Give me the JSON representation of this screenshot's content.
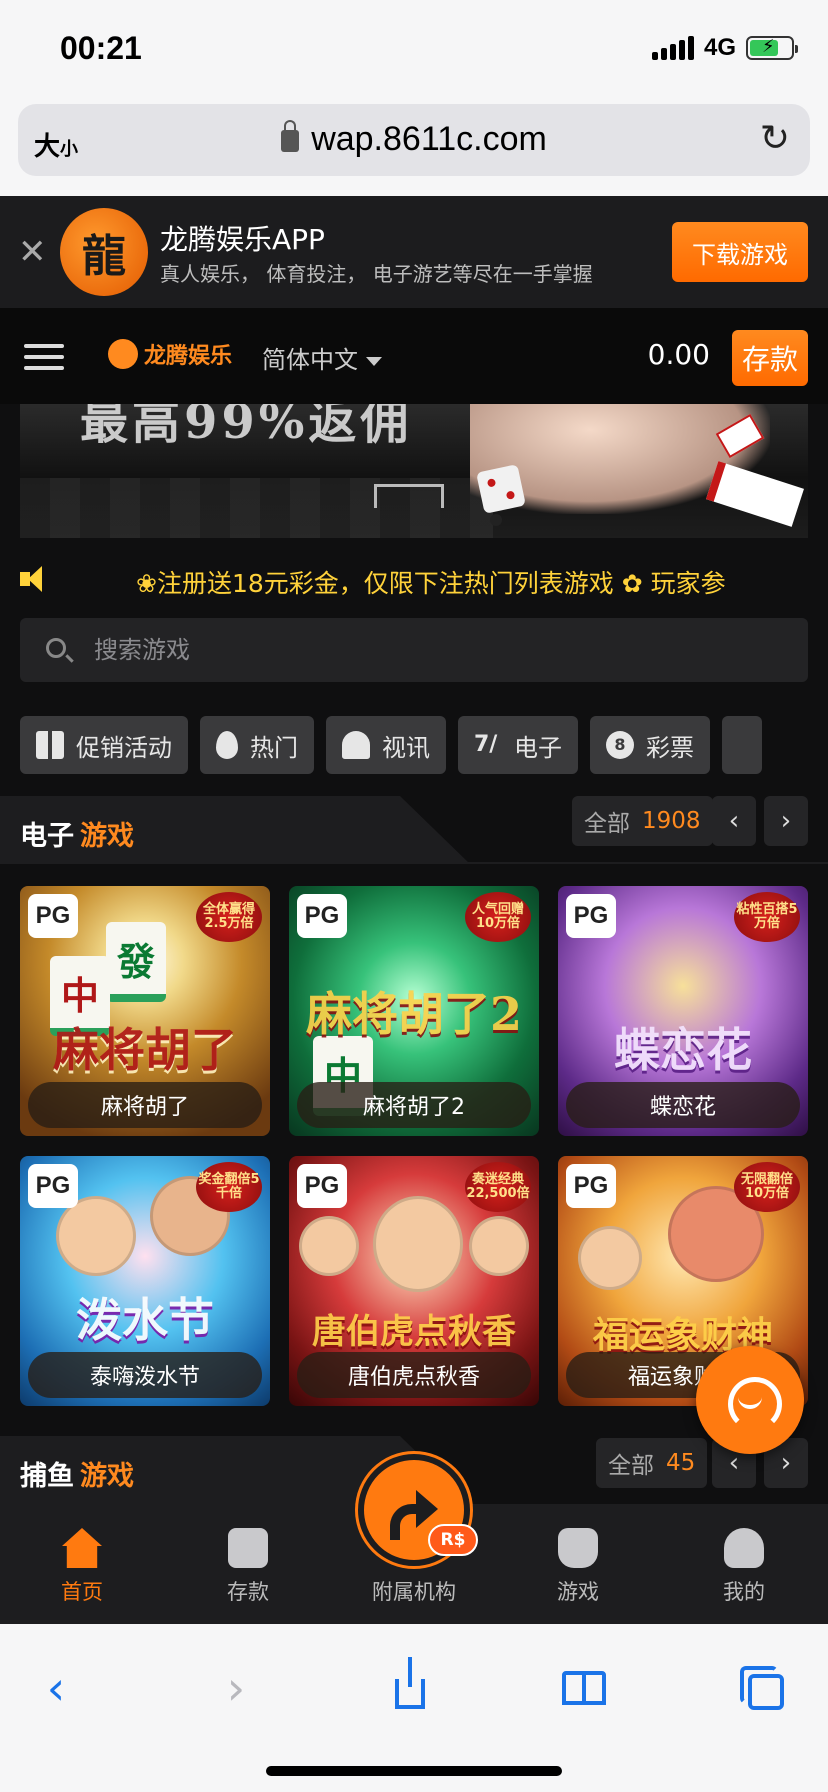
{
  "status_bar": {
    "time": "00:21",
    "network": "4G"
  },
  "browser": {
    "text_size_label": "大",
    "text_size_small": "小",
    "url": "wap.8611c.com"
  },
  "app_banner": {
    "title": "龙腾娱乐APP",
    "subtitle": "真人娱乐， 体育投注， 电子游艺等尽在一手掌握",
    "download_label": "下载游戏"
  },
  "header": {
    "brand": "龙腾娱乐",
    "language": "简体中文",
    "balance": "0.00",
    "deposit_label": "存款"
  },
  "hero": {
    "text": "最高99%返佣"
  },
  "marquee": {
    "text": "❀注册送18元彩金，仅限下注热门列表游戏     ✿ 玩家参"
  },
  "search": {
    "placeholder": "搜索游戏"
  },
  "tabs": [
    {
      "label": "促销活动",
      "icon": "gift-icon"
    },
    {
      "label": "热门",
      "icon": "fire-icon"
    },
    {
      "label": "视讯",
      "icon": "live-dealer-icon"
    },
    {
      "label": "电子",
      "icon": "slot-icon"
    },
    {
      "label": "彩票",
      "icon": "lottery-ball-icon",
      "ball_number": "8"
    }
  ],
  "slots_section": {
    "title_main": "电子",
    "title_accent": "游戏",
    "all_label": "全部",
    "count": "1908",
    "games": [
      {
        "name": "麻将胡了",
        "provider": "PG",
        "tag": "全体赢得2.5万倍",
        "art_title": "麻将胡了"
      },
      {
        "name": "麻将胡了2",
        "provider": "PG",
        "tag": "人气回赠10万倍",
        "art_title": "麻将胡了2"
      },
      {
        "name": "蝶恋花",
        "provider": "PG",
        "tag": "粘性百搭5万倍",
        "art_title": "蝶恋花"
      },
      {
        "name": "泰嗨泼水节",
        "provider": "PG",
        "tag": "奖金翻倍5千倍",
        "art_title": "泼水节"
      },
      {
        "name": "唐伯虎点秋香",
        "provider": "PG",
        "tag": "奏迷经典22,500倍",
        "art_title": "唐伯虎点秋香"
      },
      {
        "name": "福运象财神",
        "provider": "PG",
        "tag": "无限翻倍10万倍",
        "art_title": "福运象财神"
      }
    ]
  },
  "fishing_section": {
    "title_main": "捕鱼",
    "title_accent": "游戏",
    "all_label": "全部",
    "count": "45"
  },
  "bottom_nav": {
    "home": "首页",
    "deposit": "存款",
    "affiliate": "附属机构",
    "affiliate_badge": "R$",
    "games": "游戏",
    "mine": "我的"
  },
  "colors": {
    "accent": "#ff7a10",
    "marquee": "#ffd23a",
    "safari_blue": "#1a73e8"
  }
}
